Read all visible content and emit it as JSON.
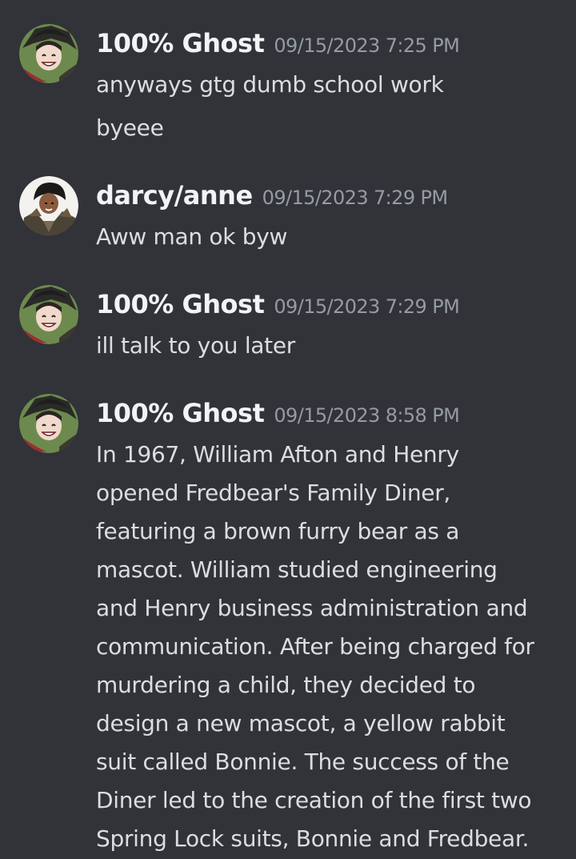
{
  "messages": [
    {
      "author": "100% Ghost",
      "timestamp": "09/15/2023 7:25 PM",
      "avatar_icon": "user-avatar-ghost",
      "lines": [
        "anyways gtg dumb school work",
        "byeee"
      ]
    },
    {
      "author": "darcy/anne",
      "timestamp": "09/15/2023 7:29 PM",
      "avatar_icon": "user-avatar-darcy",
      "lines": [
        "Aww man ok byw"
      ]
    },
    {
      "author": "100% Ghost",
      "timestamp": "09/15/2023 7:29 PM",
      "avatar_icon": "user-avatar-ghost",
      "lines": [
        "ill talk to you later"
      ]
    },
    {
      "author": "100% Ghost",
      "timestamp": "09/15/2023 8:58 PM",
      "avatar_icon": "user-avatar-ghost",
      "lines": [
        "In 1967, William Afton and Henry",
        "opened Fredbear's Family Diner,",
        "featuring a brown furry bear as a",
        "mascot. William studied engineering",
        "and Henry business administration and",
        "communication. After being charged for",
        "murdering a child, they decided to",
        "design a new mascot, a yellow rabbit",
        "suit called Bonnie. The success of the",
        "Diner led to the creation of the first two",
        "Spring Lock suits, Bonnie and Fredbear."
      ]
    }
  ],
  "colors": {
    "background": "#313338",
    "username": "#f2f3f5",
    "timestamp": "#949ba4",
    "message_text": "#dbdee1"
  }
}
